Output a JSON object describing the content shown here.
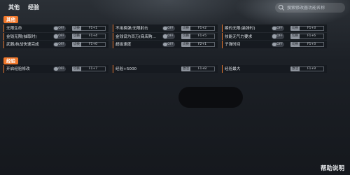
{
  "nav": {
    "tabs": [
      "其他",
      "经验"
    ]
  },
  "search": {
    "placeholder": "搜索修改器功能名称"
  },
  "sections": [
    {
      "title": "其他",
      "rows": [
        {
          "label": "无限生命",
          "toggle": "OFF",
          "action": "切换",
          "key": "F1+1"
        },
        {
          "label": "不用换弹/无限射击",
          "toggle": "OFF",
          "action": "切换",
          "key": "F1+2"
        },
        {
          "label": "瞬的无限(装弹时)",
          "toggle": "OFF",
          "action": "切换",
          "key": "F1+3"
        },
        {
          "label": "金钱无限(抽取时)",
          "toggle": "OFF",
          "action": "切换",
          "key": "F1+4"
        },
        {
          "label": "金钱设为百万(商店购...",
          "toggle": "OFF",
          "action": "切换",
          "key": "F1+5"
        },
        {
          "label": "技能无气力要求",
          "toggle": "OFF",
          "action": "切换",
          "key": "F1+6"
        },
        {
          "label": "武器/执战快速完成",
          "toggle": "OFF",
          "action": "切换",
          "key": "F1+0"
        },
        {
          "label": "超级速度",
          "toggle": "OFF",
          "action": "切换",
          "key": "F2+1"
        },
        {
          "label": "子弹时间",
          "toggle": "OFF",
          "action": "切换",
          "key": "F1+3"
        }
      ]
    },
    {
      "title": "经验",
      "rows": [
        {
          "label": "开启经验修改",
          "toggle": "OFF",
          "action": "切换",
          "key": "F1+7"
        },
        {
          "label": "经验+5000",
          "action": "激活",
          "key": "F1+8"
        },
        {
          "label": "经验最大",
          "action": "激活",
          "key": "F1+9"
        }
      ]
    }
  ],
  "footer": {
    "help": "帮助说明"
  },
  "icons": {
    "search": "search-icon"
  },
  "colors": {
    "accent": "#f0782c"
  }
}
